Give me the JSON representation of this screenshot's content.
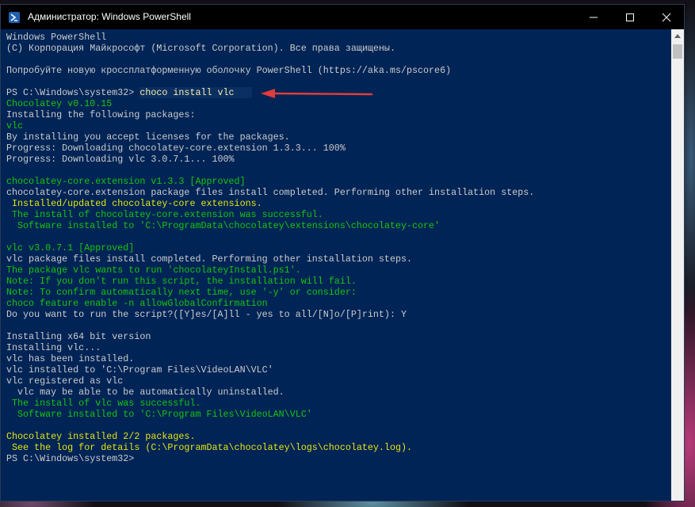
{
  "window": {
    "title": "Администратор: Windows PowerShell"
  },
  "titlebar_buttons": {
    "minimize": "minimize",
    "maximize": "maximize",
    "close": "close"
  },
  "console": {
    "prompt": "PS C:\\Windows\\system32> ",
    "command": "choco install vlc",
    "lines": [
      {
        "text": "Windows PowerShell",
        "color": "white"
      },
      {
        "text": "(C) Корпорация Майкрософт (Microsoft Corporation). Все права защищены.",
        "color": "white"
      },
      {
        "text": "",
        "color": "white"
      },
      {
        "text": "Попробуйте новую кроссплатформенную оболочку PowerShell (https://aka.ms/pscore6)",
        "color": "white"
      },
      {
        "text": "",
        "color": "white"
      },
      {
        "text": "__PROMPT_CMD__",
        "color": "white"
      },
      {
        "text": "Chocolatey v0.10.15",
        "color": "green"
      },
      {
        "text": "Installing the following packages:",
        "color": "white"
      },
      {
        "text": "vlc",
        "color": "green"
      },
      {
        "text": "By installing you accept licenses for the packages.",
        "color": "white"
      },
      {
        "text": "Progress: Downloading chocolatey-core.extension 1.3.3... 100%",
        "color": "white"
      },
      {
        "text": "Progress: Downloading vlc 3.0.7.1... 100%",
        "color": "white"
      },
      {
        "text": "",
        "color": "white"
      },
      {
        "text": "chocolatey-core.extension v1.3.3 [Approved]",
        "color": "green"
      },
      {
        "text": "chocolatey-core.extension package files install completed. Performing other installation steps.",
        "color": "white"
      },
      {
        "text": " Installed/updated chocolatey-core extensions.",
        "color": "yellowb"
      },
      {
        "text": " The install of chocolatey-core.extension was successful.",
        "color": "green"
      },
      {
        "text": "  Software installed to 'C:\\ProgramData\\chocolatey\\extensions\\chocolatey-core'",
        "color": "green"
      },
      {
        "text": "",
        "color": "white"
      },
      {
        "text": "vlc v3.0.7.1 [Approved]",
        "color": "green"
      },
      {
        "text": "vlc package files install completed. Performing other installation steps.",
        "color": "white"
      },
      {
        "text": "The package vlc wants to run 'chocolateyInstall.ps1'.",
        "color": "green"
      },
      {
        "text": "Note: If you don't run this script, the installation will fail.",
        "color": "green"
      },
      {
        "text": "Note: To confirm automatically next time, use '-y' or consider:",
        "color": "green"
      },
      {
        "text": "choco feature enable -n allowGlobalConfirmation",
        "color": "green"
      },
      {
        "text": "Do you want to run the script?([Y]es/[A]ll - yes to all/[N]o/[P]rint): Y",
        "color": "white"
      },
      {
        "text": "",
        "color": "white"
      },
      {
        "text": "Installing x64 bit version",
        "color": "white"
      },
      {
        "text": "Installing vlc...",
        "color": "white"
      },
      {
        "text": "vlc has been installed.",
        "color": "white"
      },
      {
        "text": "vlc installed to 'C:\\Program Files\\VideoLAN\\VLC'",
        "color": "white"
      },
      {
        "text": "vlc registered as vlc",
        "color": "white"
      },
      {
        "text": "  vlc may be able to be automatically uninstalled.",
        "color": "white"
      },
      {
        "text": " The install of vlc was successful.",
        "color": "green"
      },
      {
        "text": "  Software installed to 'C:\\Program Files\\VideoLAN\\VLC'",
        "color": "green"
      },
      {
        "text": "",
        "color": "white"
      },
      {
        "text": "Chocolatey installed 2/2 packages.",
        "color": "yellowb"
      },
      {
        "text": " See the log for details (C:\\ProgramData\\chocolatey\\logs\\chocolatey.log).",
        "color": "yellowb"
      },
      {
        "text": "PS C:\\Windows\\system32> ",
        "color": "white"
      }
    ]
  },
  "colors": {
    "console_bg": "#012456",
    "text_white": "#cccccc",
    "text_green": "#16c60c",
    "text_yellow": "#e5e510",
    "arrow_red": "#e03c3c"
  },
  "icons": {
    "app": "powershell-icon",
    "arrow": "red-arrow-annotation"
  }
}
